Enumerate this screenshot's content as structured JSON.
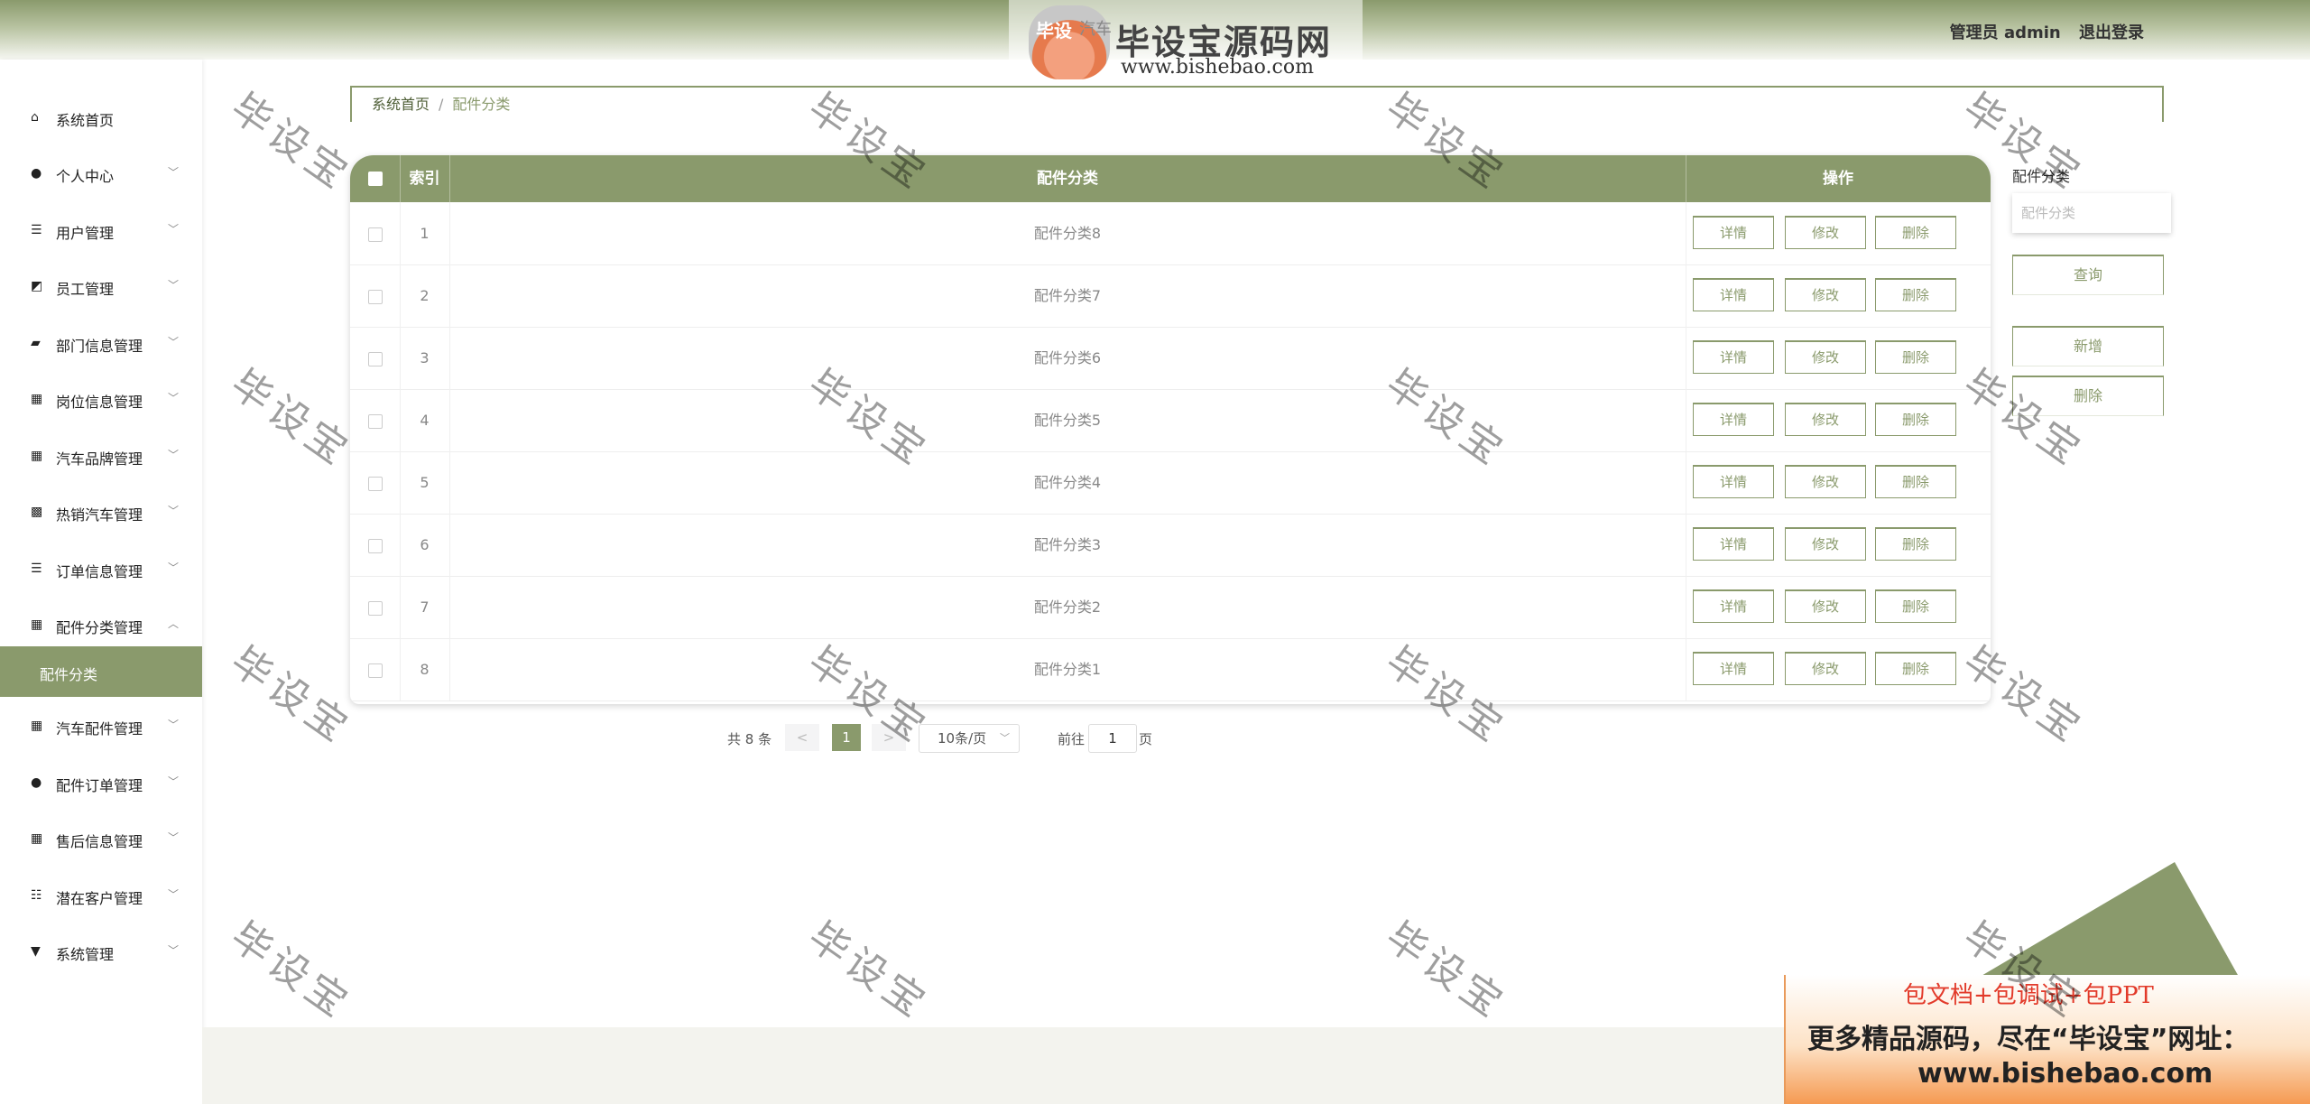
{
  "header": {
    "user_label": "管理员 admin",
    "logout_label": "退出登录",
    "logo_cn": "毕设宝源码网",
    "logo_en": "www.bishebao.com",
    "logo_badge": "毕设",
    "logo_faded": "汽车"
  },
  "sidebar": {
    "items": [
      {
        "label": "系统首页",
        "icon": "home-icon"
      },
      {
        "label": "个人中心",
        "icon": "user-icon"
      },
      {
        "label": "用户管理",
        "icon": "list-icon"
      },
      {
        "label": "员工管理",
        "icon": "chart-icon"
      },
      {
        "label": "部门信息管理",
        "icon": "ticket-icon"
      },
      {
        "label": "岗位信息管理",
        "icon": "grid-icon"
      },
      {
        "label": "汽车品牌管理",
        "icon": "grid-icon"
      },
      {
        "label": "热销汽车管理",
        "icon": "message-icon"
      },
      {
        "label": "订单信息管理",
        "icon": "list-icon"
      },
      {
        "label": "配件分类管理",
        "icon": "grid-icon"
      },
      {
        "label": "汽车配件管理",
        "icon": "grid-icon"
      },
      {
        "label": "配件订单管理",
        "icon": "pin-icon"
      },
      {
        "label": "售后信息管理",
        "icon": "grid-icon"
      },
      {
        "label": "潜在客户管理",
        "icon": "sliders-icon"
      },
      {
        "label": "系统管理",
        "icon": "shop-icon"
      }
    ],
    "active_sub": "配件分类"
  },
  "breadcrumb": {
    "home": "系统首页",
    "sep": "/",
    "current": "配件分类"
  },
  "table": {
    "headers": {
      "index": "索引",
      "name": "配件分类",
      "actions": "操作"
    },
    "rows": [
      {
        "index": "1",
        "name": "配件分类8"
      },
      {
        "index": "2",
        "name": "配件分类7"
      },
      {
        "index": "3",
        "name": "配件分类6"
      },
      {
        "index": "4",
        "name": "配件分类5"
      },
      {
        "index": "5",
        "name": "配件分类4"
      },
      {
        "index": "6",
        "name": "配件分类3"
      },
      {
        "index": "7",
        "name": "配件分类2"
      },
      {
        "index": "8",
        "name": "配件分类1"
      }
    ],
    "actions": {
      "detail": "详情",
      "edit": "修改",
      "delete": "删除"
    }
  },
  "pagination": {
    "total": "共 8 条",
    "prev": "<",
    "current": "1",
    "next": ">",
    "page_size": "10条/页",
    "goto_label": "前往",
    "goto_value": "1",
    "page_unit": "页"
  },
  "search_panel": {
    "label": "配件分类",
    "placeholder": "配件分类",
    "query": "查询",
    "add": "新增",
    "delete": "删除"
  },
  "watermark": "毕设宝",
  "banner": {
    "line1": "包文档+包调试+包PPT",
    "line2": "更多精品源码，尽在“毕设宝”网址：",
    "line3": "www.bishebao.com"
  },
  "colors": {
    "accent": "#8a9a6c",
    "accent_dark": "#4f5f37"
  }
}
